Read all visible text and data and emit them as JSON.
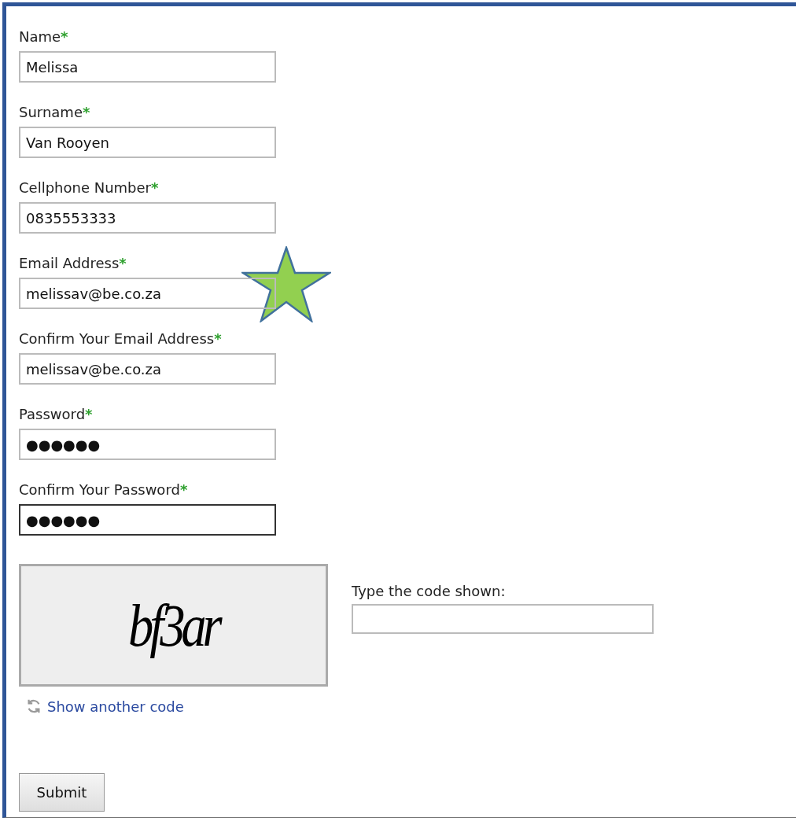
{
  "fields": [
    {
      "label": "Name",
      "required_mark": "*",
      "value": "Melissa",
      "focused": false
    },
    {
      "label": "Surname",
      "required_mark": "*",
      "value": "Van Rooyen",
      "focused": false
    },
    {
      "label": "Cellphone Number",
      "required_mark": "*",
      "value": "0835553333",
      "focused": false
    },
    {
      "label": "Email Address",
      "required_mark": "*",
      "value": "melissav@be.co.za",
      "focused": false
    },
    {
      "label": "Confirm Your Email Address",
      "required_mark": "*",
      "value": "melissav@be.co.za",
      "focused": false
    },
    {
      "label": "Password",
      "required_mark": "*",
      "value": "●●●●●●",
      "focused": false
    },
    {
      "label": "Confirm Your Password",
      "required_mark": "*",
      "value": "●●●●●●",
      "focused": true
    }
  ],
  "captcha": {
    "code": "bf3ar",
    "prompt": "Type the code shown:",
    "refresh_link": "Show another code"
  },
  "submit_button": "Submit"
}
